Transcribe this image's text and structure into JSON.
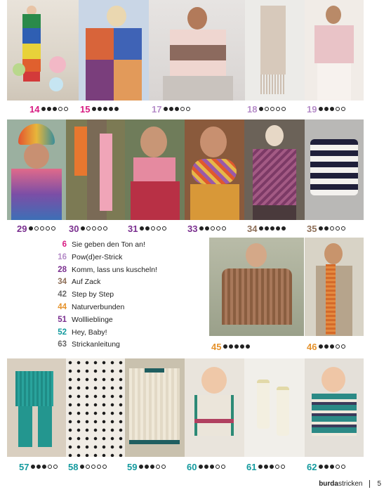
{
  "palette": {
    "pink": "#d81b82",
    "purple": "#7a2f8f",
    "lilac": "#b58cc8",
    "gray": "#6a6a6a",
    "teal": "#139a9e",
    "orange": "#e5922b",
    "brown": "#8d6e57",
    "yellowgreen": "#b7a53a",
    "blue": "#3b5aa8"
  },
  "rows": {
    "row1": [
      {
        "page": "14",
        "rating": 3,
        "color": "#d81b82",
        "icon": "model-rainbow-dress-photo"
      },
      {
        "page": "15",
        "rating": 5,
        "color": "#d81b82",
        "icon": "model-patchwork-cardigan-photo"
      },
      {
        "page": "17",
        "rating": 3,
        "color": "#b58cc8",
        "icon": "model-striped-sweater-photo"
      },
      {
        "page": "18",
        "rating": 1,
        "color": "#b58cc8",
        "icon": "fringe-scarf-photo"
      },
      {
        "page": "19",
        "rating": 3,
        "color": "#b58cc8",
        "icon": "model-pink-mesh-sweater-photo"
      }
    ],
    "row2": [
      {
        "page": "29",
        "rating": 1,
        "color": "#7a2f8f",
        "icon": "model-gradient-hat-scarf-photo"
      },
      {
        "page": "30",
        "rating": 1,
        "color": "#7a2f8f",
        "icon": "tree-scarves-photo"
      },
      {
        "page": "31",
        "rating": 2,
        "color": "#7a2f8f",
        "icon": "model-pink-scarf-photo"
      },
      {
        "page": "33",
        "rating": 2,
        "color": "#7a2f8f",
        "icon": "model-mixed-cowl-photo"
      },
      {
        "page": "34",
        "rating": 5,
        "color": "#8d6e57",
        "icon": "model-chevron-vest-photo"
      },
      {
        "page": "35",
        "rating": 2,
        "color": "#8d6e57",
        "icon": "zigzag-pillow-photo"
      }
    ],
    "row3": [
      {
        "page": "45",
        "rating": 5,
        "color": "#e5922b",
        "icon": "model-brown-rib-sweater-photo"
      },
      {
        "page": "46",
        "rating": 3,
        "color": "#e5922b",
        "icon": "model-orange-scarf-photo"
      }
    ],
    "row4": [
      {
        "page": "57",
        "rating": 3,
        "color": "#139a9e",
        "icon": "baby-teal-romper-photo"
      },
      {
        "page": "58",
        "rating": 1,
        "color": "#139a9e",
        "icon": "bobble-blanket-photo"
      },
      {
        "page": "59",
        "rating": 3,
        "color": "#139a9e",
        "icon": "cricket-sweater-photo"
      },
      {
        "page": "60",
        "rating": 3,
        "color": "#139a9e",
        "icon": "baby-cardigan-photo"
      },
      {
        "page": "61",
        "rating": 3,
        "color": "#139a9e",
        "icon": "baby-socks-photo"
      },
      {
        "page": "62",
        "rating": 3,
        "color": "#139a9e",
        "icon": "baby-polo-sweater-photo"
      }
    ]
  },
  "toc": [
    {
      "num": "6",
      "title": "Sie geben den Ton an!",
      "color": "#d81b82"
    },
    {
      "num": "16",
      "title": "Pow(d)er-Strick",
      "color": "#b58cc8"
    },
    {
      "num": "28",
      "title": "Komm, lass uns kuscheln!",
      "color": "#7a2f8f"
    },
    {
      "num": "34",
      "title": "Auf Zack",
      "color": "#8d6e57"
    },
    {
      "num": "42",
      "title": "Step by Step",
      "color": "#6a6a6a"
    },
    {
      "num": "44",
      "title": "Naturverbunden",
      "color": "#e5922b"
    },
    {
      "num": "51",
      "title": "Wolllieblinge",
      "color": "#7a2f8f"
    },
    {
      "num": "52",
      "title": "Hey, Baby!",
      "color": "#139a9e"
    },
    {
      "num": "63",
      "title": "Strickanleitung",
      "color": "#6a6a6a"
    }
  ],
  "footer": {
    "brand_bold": "burda",
    "brand_light": "stricken",
    "page_number": "5"
  }
}
